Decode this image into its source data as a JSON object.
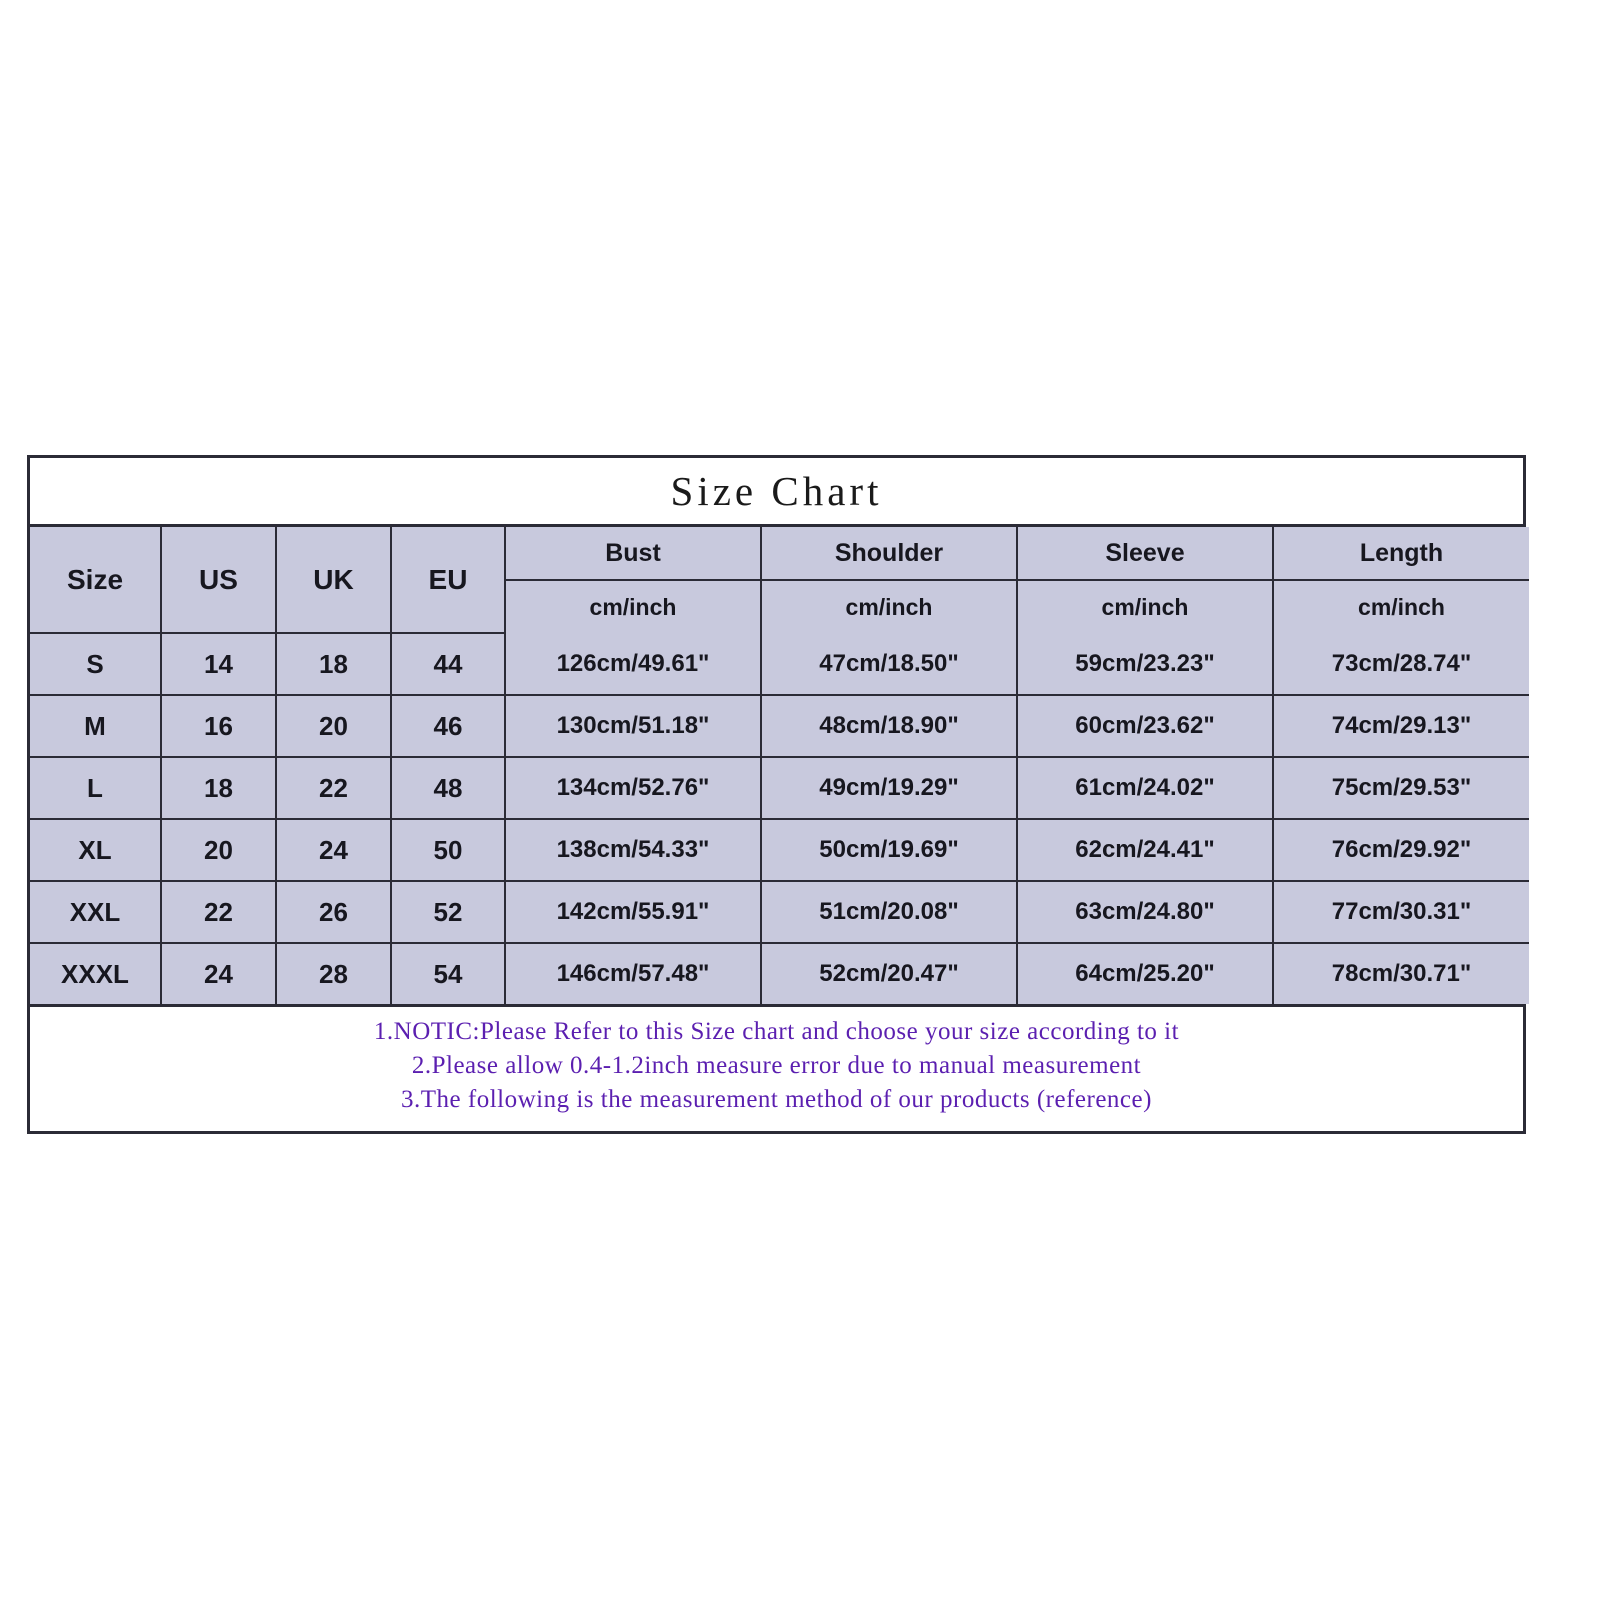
{
  "title": "Size Chart",
  "colors": {
    "cell_fill": "#c8c9dd",
    "border": "#2b2b36",
    "note_text": "#5b1fb0",
    "page_background": "#ffffff",
    "title_text": "#1a1a1a"
  },
  "table": {
    "corner_header": "Size",
    "simple_headers": [
      "US",
      "UK",
      "EU"
    ],
    "measure_groups": [
      {
        "label": "Bust",
        "unit": "cm/inch"
      },
      {
        "label": "Shoulder",
        "unit": "cm/inch"
      },
      {
        "label": "Sleeve",
        "unit": "cm/inch"
      },
      {
        "label": "Length",
        "unit": "cm/inch"
      }
    ],
    "rows": [
      {
        "size": "S",
        "us": "14",
        "uk": "18",
        "eu": "44",
        "bust": "126cm/49.61\"",
        "shoulder": "47cm/18.50\"",
        "sleeve": "59cm/23.23\"",
        "length": "73cm/28.74\""
      },
      {
        "size": "M",
        "us": "16",
        "uk": "20",
        "eu": "46",
        "bust": "130cm/51.18\"",
        "shoulder": "48cm/18.90\"",
        "sleeve": "60cm/23.62\"",
        "length": "74cm/29.13\""
      },
      {
        "size": "L",
        "us": "18",
        "uk": "22",
        "eu": "48",
        "bust": "134cm/52.76\"",
        "shoulder": "49cm/19.29\"",
        "sleeve": "61cm/24.02\"",
        "length": "75cm/29.53\""
      },
      {
        "size": "XL",
        "us": "20",
        "uk": "24",
        "eu": "50",
        "bust": "138cm/54.33\"",
        "shoulder": "50cm/19.69\"",
        "sleeve": "62cm/24.41\"",
        "length": "76cm/29.92\""
      },
      {
        "size": "XXL",
        "us": "22",
        "uk": "26",
        "eu": "52",
        "bust": "142cm/55.91\"",
        "shoulder": "51cm/20.08\"",
        "sleeve": "63cm/24.80\"",
        "length": "77cm/30.31\""
      },
      {
        "size": "XXXL",
        "us": "24",
        "uk": "28",
        "eu": "54",
        "bust": "146cm/57.48\"",
        "shoulder": "52cm/20.47\"",
        "sleeve": "64cm/25.20\"",
        "length": "78cm/30.71\""
      }
    ]
  },
  "notes": [
    "1.NOTIC:Please Refer to this Size chart and choose your size according to it",
    "2.Please allow 0.4-1.2inch measure error due to manual measurement",
    "3.The following is the measurement method of our products (reference)"
  ],
  "chart_data": {
    "type": "table",
    "title": "Size Chart",
    "columns": [
      "Size",
      "US",
      "UK",
      "EU",
      "Bust cm/inch",
      "Shoulder cm/inch",
      "Sleeve cm/inch",
      "Length cm/inch"
    ],
    "rows": [
      [
        "S",
        "14",
        "18",
        "44",
        "126cm/49.61\"",
        "47cm/18.50\"",
        "59cm/23.23\"",
        "73cm/28.74\""
      ],
      [
        "M",
        "16",
        "20",
        "46",
        "130cm/51.18\"",
        "48cm/18.90\"",
        "60cm/23.62\"",
        "74cm/29.13\""
      ],
      [
        "L",
        "18",
        "22",
        "48",
        "134cm/52.76\"",
        "49cm/19.29\"",
        "61cm/24.02\"",
        "75cm/29.53\""
      ],
      [
        "XL",
        "20",
        "24",
        "50",
        "138cm/54.33\"",
        "50cm/19.69\"",
        "62cm/24.41\"",
        "76cm/29.92\""
      ],
      [
        "XXL",
        "22",
        "26",
        "52",
        "142cm/55.91\"",
        "51cm/20.08\"",
        "63cm/24.80\"",
        "77cm/30.31\""
      ],
      [
        "XXXL",
        "24",
        "28",
        "54",
        "146cm/57.48\"",
        "52cm/20.47\"",
        "64cm/25.20\"",
        "78cm/30.71\""
      ]
    ]
  }
}
